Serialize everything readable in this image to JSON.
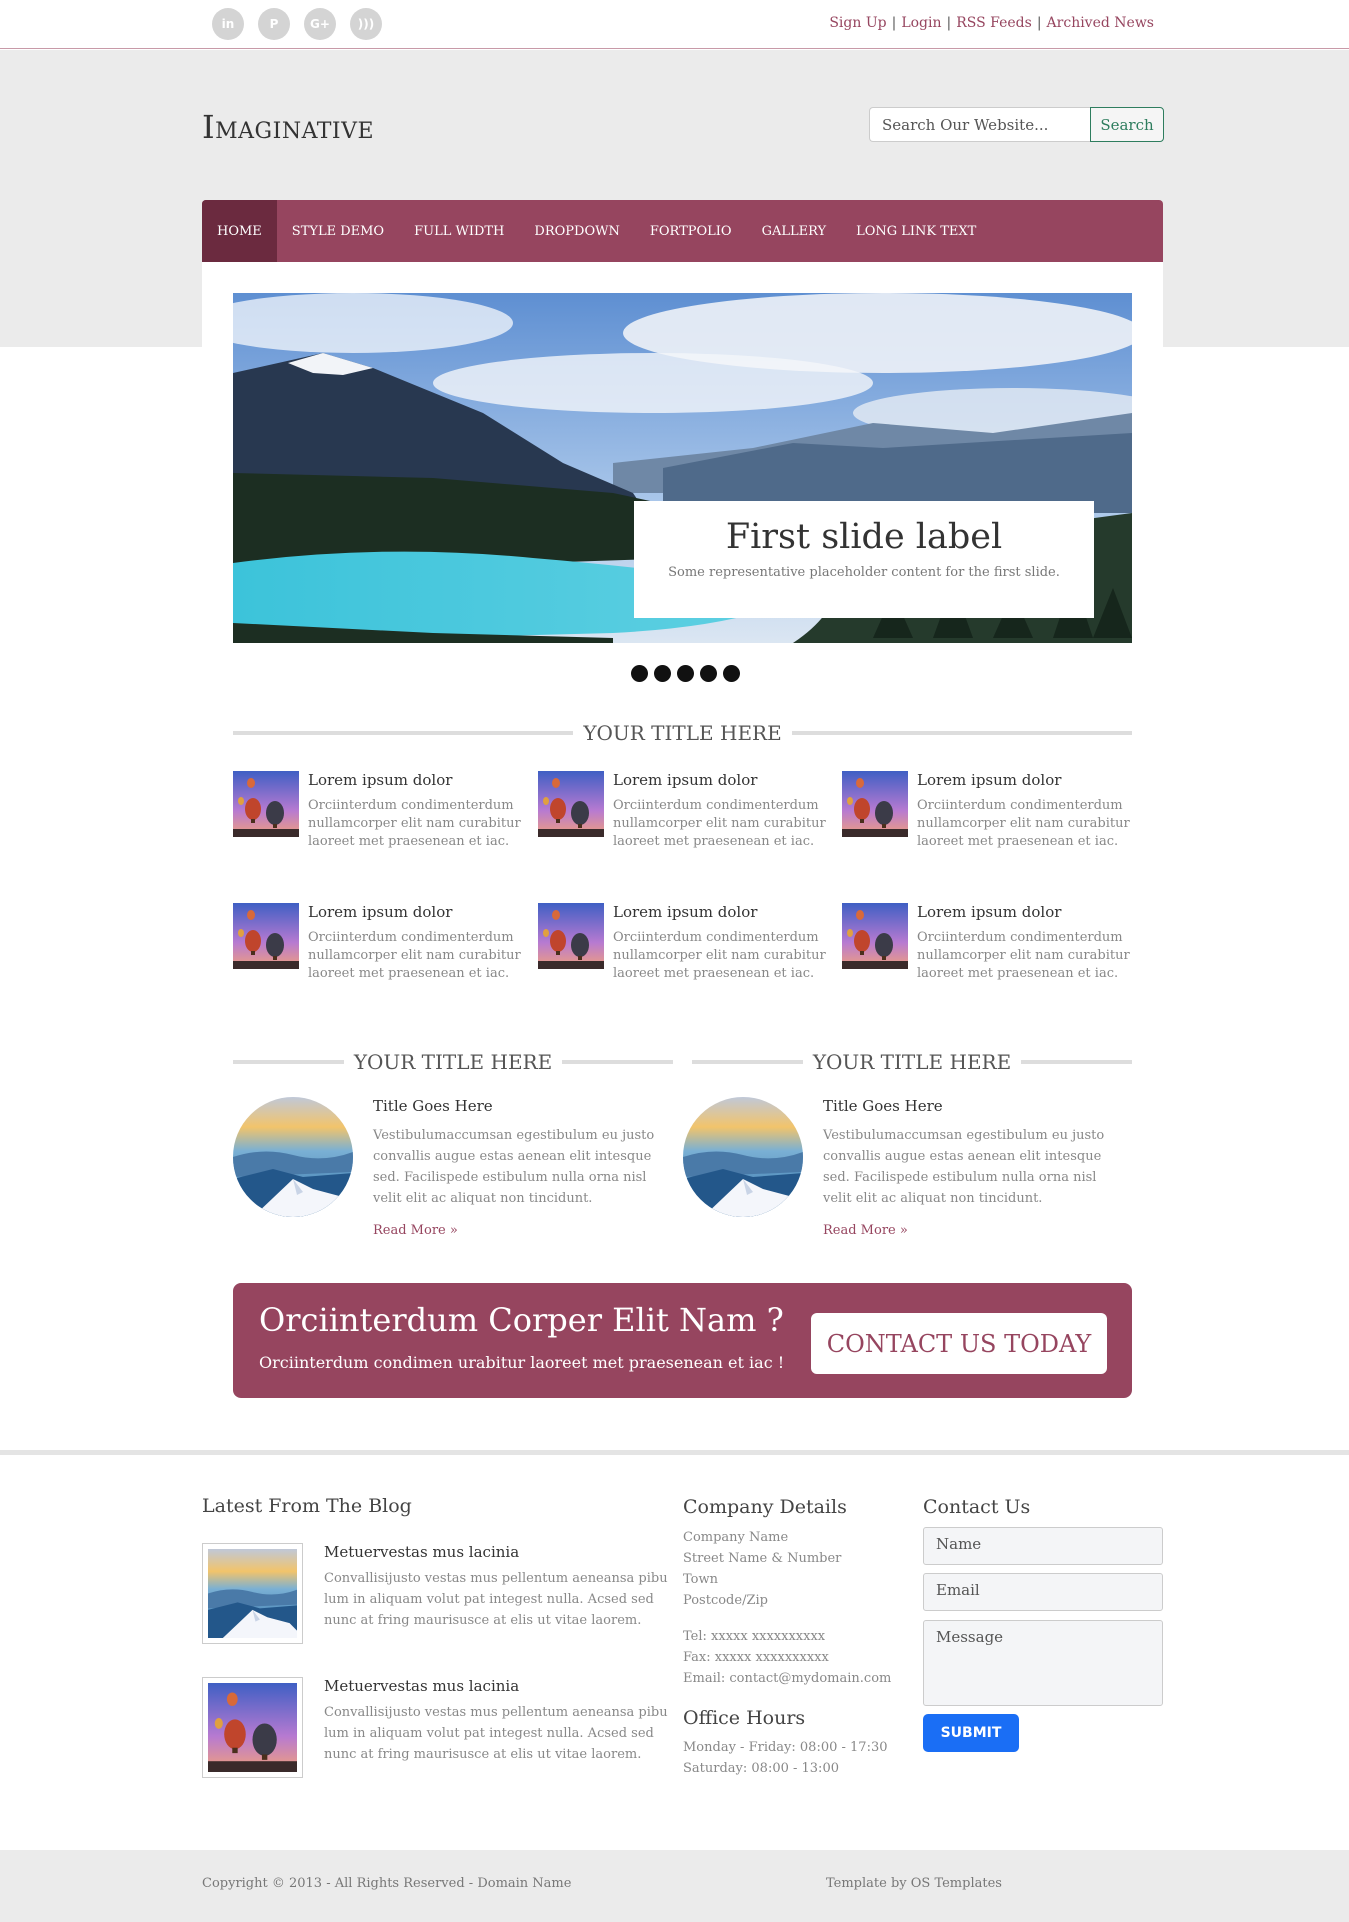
{
  "topbar": {
    "social": [
      {
        "icon": "linkedin-icon",
        "glyph": "in"
      },
      {
        "icon": "pinterest-icon",
        "glyph": "P"
      },
      {
        "icon": "google-plus-icon",
        "glyph": "G+"
      },
      {
        "icon": "rss-icon",
        "glyph": ")))"
      }
    ],
    "links": [
      "Sign Up",
      "Login",
      "RSS Feeds",
      "Archived News"
    ],
    "separator": "|"
  },
  "header": {
    "logo": "Imaginative",
    "search_placeholder": "Search Our Website...",
    "search_button": "Search"
  },
  "nav": {
    "items": [
      "Home",
      "Style Demo",
      "Full Width",
      "Dropdown",
      "Fortpolio",
      "Gallery",
      "Long Link Text"
    ],
    "active": "Home"
  },
  "slider": {
    "caption_title": "First slide label",
    "caption_text": "Some representative placeholder content for the first slide.",
    "dot_count": 5
  },
  "features": {
    "title": "Your Title Here",
    "items": [
      {
        "title": "Lorem ipsum dolor",
        "text": "Orciinterdum condimenterdum nullamcorper elit nam curabitur laoreet met praesenean et iac."
      },
      {
        "title": "Lorem ipsum dolor",
        "text": "Orciinterdum condimenterdum nullamcorper elit nam curabitur laoreet met praesenean et iac."
      },
      {
        "title": "Lorem ipsum dolor",
        "text": "Orciinterdum condimenterdum nullamcorper elit nam curabitur laoreet met praesenean et iac."
      },
      {
        "title": "Lorem ipsum dolor",
        "text": "Orciinterdum condimenterdum nullamcorper elit nam curabitur laoreet met praesenean et iac."
      },
      {
        "title": "Lorem ipsum dolor",
        "text": "Orciinterdum condimenterdum nullamcorper elit nam curabitur laoreet met praesenean et iac."
      },
      {
        "title": "Lorem ipsum dolor",
        "text": "Orciinterdum condimenterdum nullamcorper elit nam curabitur laoreet met praesenean et iac."
      }
    ]
  },
  "posts": [
    {
      "section_title": "Your Title Here",
      "title": "Title Goes Here",
      "text": "Vestibulumaccumsan egestibulum eu justo convallis augue estas aenean elit intesque sed. Facilispede estibulum nulla orna nisl velit elit ac aliquat non tincidunt.",
      "link": "Read More »"
    },
    {
      "section_title": "Your Title Here",
      "title": "Title Goes Here",
      "text": "Vestibulumaccumsan egestibulum eu justo convallis augue estas aenean elit intesque sed. Facilispede estibulum nulla orna nisl velit elit ac aliquat non tincidunt.",
      "link": "Read More »"
    }
  ],
  "cta": {
    "heading": "Orciinterdum Corper Elit Nam ?",
    "subheading": "Orciinterdum condimen urabitur laoreet met praesenean et iac !",
    "button": "CONTACT US TODAY"
  },
  "footer": {
    "blog": {
      "heading": "Latest From The Blog",
      "items": [
        {
          "title": "Metuervestas mus lacinia",
          "text": "Convallisijusto vestas mus pellentum aeneansa pibu lum in aliquam volut pat integest nulla. Acsed sed nunc at fring maurisusce at elis ut vitae laorem."
        },
        {
          "title": "Metuervestas mus lacinia",
          "text": "Convallisijusto vestas mus pellentum aeneansa pibu lum in aliquam volut pat integest nulla. Acsed sed nunc at fring maurisusce at elis ut vitae laorem."
        }
      ]
    },
    "company": {
      "heading": "Company Details",
      "lines": [
        "Company Name",
        "Street Name & Number",
        "Town",
        "Postcode/Zip"
      ],
      "tel": "Tel: xxxxx xxxxxxxxxx",
      "fax": "Fax: xxxxx xxxxxxxxxx",
      "email": "Email: contact@mydomain.com"
    },
    "hours": {
      "heading": "Office Hours",
      "weekday": "Monday - Friday: 08:00 - 17:30",
      "saturday": "Saturday: 08:00 - 13:00"
    },
    "contact": {
      "heading": "Contact Us",
      "name_placeholder": "Name",
      "email_placeholder": "Email",
      "message_placeholder": "Message",
      "submit": "SUBMIT"
    }
  },
  "bottom": {
    "copyright": "Copyright © 2013 - All Rights Reserved - Domain Name",
    "credit": "Template by OS Templates"
  },
  "colors": {
    "brand": "#96455f",
    "brand_dark": "#6b2a3f",
    "search_accent": "#2e7d5e",
    "submit": "#1a6ef5"
  }
}
